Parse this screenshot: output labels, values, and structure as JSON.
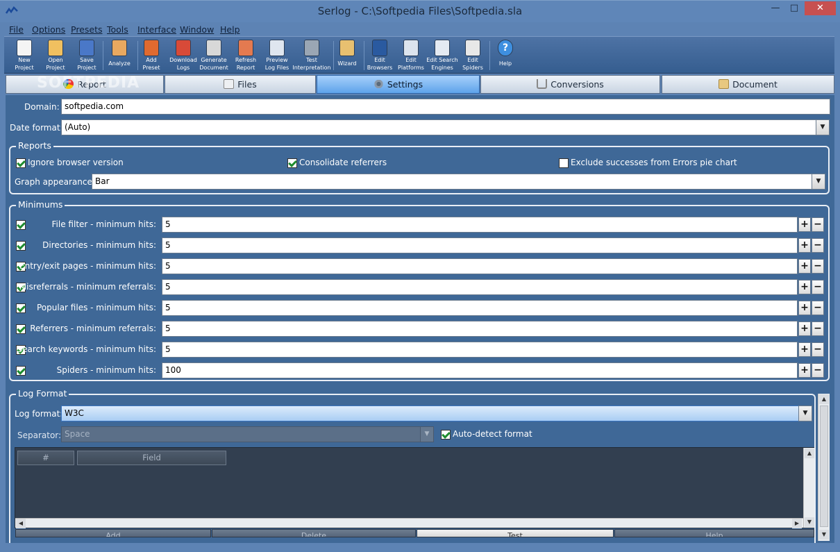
{
  "window": {
    "title": "Serlog - C:\\Softpedia Files\\Softpedia.sla"
  },
  "menu": [
    "File",
    "Options",
    "Presets",
    "Tools",
    "Interface",
    "Window",
    "Help"
  ],
  "toolbar": [
    {
      "l1": "New",
      "l2": "Project",
      "icon": "new-project-icon",
      "color": "#f4f4f4"
    },
    {
      "l1": "Open",
      "l2": "Project",
      "icon": "open-project-icon",
      "color": "#f0c060"
    },
    {
      "l1": "Save",
      "l2": "Project",
      "icon": "save-project-icon",
      "color": "#4a78c8"
    },
    {
      "l1": "Analyze",
      "l2": "",
      "icon": "analyze-icon",
      "color": "#e8a860"
    },
    {
      "l1": "Add",
      "l2": "Preset",
      "icon": "add-preset-icon",
      "color": "#e06a30"
    },
    {
      "l1": "Download",
      "l2": "Logs",
      "icon": "download-logs-icon",
      "color": "#d84a38"
    },
    {
      "l1": "Generate",
      "l2": "Document",
      "icon": "generate-document-icon",
      "color": "#d8d8d8"
    },
    {
      "l1": "Refresh",
      "l2": "Report",
      "icon": "refresh-report-icon",
      "color": "#e47a50"
    },
    {
      "l1": "Preview",
      "l2": "Log Files",
      "icon": "preview-log-files-icon",
      "color": "#dfe6ef"
    },
    {
      "l1": "Test",
      "l2": "Interpretation",
      "icon": "test-interpretation-icon",
      "color": "#9aa6b4"
    },
    {
      "l1": "Wizard",
      "l2": "",
      "icon": "wizard-icon",
      "color": "#e8c070"
    },
    {
      "l1": "Edit",
      "l2": "Browsers",
      "icon": "edit-browsers-icon",
      "color": "#2a5aa0"
    },
    {
      "l1": "Edit",
      "l2": "Platforms",
      "icon": "edit-platforms-icon",
      "color": "#dce4ee"
    },
    {
      "l1": "Edit Search",
      "l2": "Engines",
      "icon": "edit-search-engines-icon",
      "color": "#e4eaf2"
    },
    {
      "l1": "Edit",
      "l2": "Spiders",
      "icon": "edit-spiders-icon",
      "color": "#e8e8e8"
    },
    {
      "l1": "Help",
      "l2": "",
      "icon": "help-icon",
      "color": "#3e8fe0"
    }
  ],
  "tabs": [
    {
      "label": "Report",
      "icon": "report-tab-icon",
      "active": false
    },
    {
      "label": "Files",
      "icon": "files-tab-icon",
      "active": false
    },
    {
      "label": "Settings",
      "icon": "settings-tab-icon",
      "active": true
    },
    {
      "label": "Conversions",
      "icon": "conversions-tab-icon",
      "active": false
    },
    {
      "label": "Document",
      "icon": "document-tab-icon",
      "active": false
    }
  ],
  "settings": {
    "domain_label": "Domain:",
    "domain_value": "softpedia.com",
    "date_format_label": "Date format:",
    "date_format_value": "(Auto)"
  },
  "reports": {
    "title": "Reports",
    "ignore_browser_version": "Ignore browser version",
    "consolidate_referrers": "Consolidate referrers",
    "exclude_successes": "Exclude successes from Errors pie chart",
    "graph_appearance_label": "Graph appearance:",
    "graph_appearance_value": "Bar"
  },
  "minimums": {
    "title": "Minimums",
    "rows": [
      {
        "label": "File filter - minimum hits:",
        "value": "5",
        "checked": true
      },
      {
        "label": "Directories - minimum hits:",
        "value": "5",
        "checked": true
      },
      {
        "label": "Entry/exit pages - minimum hits:",
        "value": "5",
        "checked": true
      },
      {
        "label": "Misreferrals - minimum referrals:",
        "value": "5",
        "checked": true
      },
      {
        "label": "Popular files - minimum hits:",
        "value": "5",
        "checked": true
      },
      {
        "label": "Referrers - minimum referrals:",
        "value": "5",
        "checked": true
      },
      {
        "label": "Search keywords - minimum hits:",
        "value": "5",
        "checked": true
      },
      {
        "label": "Spiders - minimum hits:",
        "value": "100",
        "checked": true
      }
    ]
  },
  "log_format": {
    "title": "Log Format",
    "format_label": "Log format:",
    "format_value": "W3C",
    "separator_label": "Separator:",
    "separator_value": "Space",
    "auto_detect": "Auto-detect format",
    "col_num": "#",
    "col_field": "Field",
    "buttons": [
      "Add",
      "Delete",
      "Test",
      "Help"
    ]
  },
  "watermark": "SOFTPEDIA"
}
